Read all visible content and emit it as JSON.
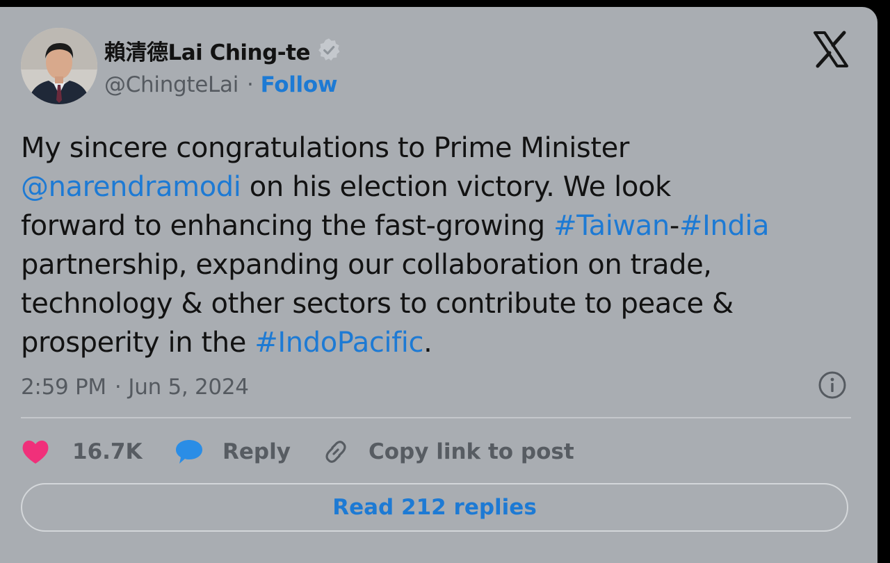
{
  "author": {
    "display_name": "賴清德Lai Ching-te",
    "handle": "@ChingteLai",
    "separator": "·",
    "follow_label": "Follow"
  },
  "tweet": {
    "line1": "My sincere congratulations to Prime Minister",
    "mention": "@narendramodi",
    "line2_rest": " on his election victory. We look",
    "line3_start": "forward to enhancing the fast-growing ",
    "hashtag_taiwan": "#Taiwan",
    "dash": "-",
    "hashtag_india": "#India",
    "line4": "partnership, expanding our collaboration on trade,",
    "line5": "technology & other sectors to contribute to peace &",
    "line6_start": "prosperity in the ",
    "hashtag_indopacific": "#IndoPacific",
    "line6_end": "."
  },
  "meta": {
    "time": "2:59 PM",
    "separator": "·",
    "date": "Jun 5, 2024"
  },
  "actions": {
    "like_count": "16.7K",
    "reply_label": "Reply",
    "copy_label": "Copy link to post"
  },
  "read_replies_label": "Read 212 replies",
  "colors": {
    "card_bg": "#a9adb2",
    "link_blue": "#1d7ad4",
    "heart_pink": "#f0307a",
    "reply_blue": "#2a8de6",
    "muted_text": "#555a60"
  },
  "icons": [
    "verified-badge-icon",
    "x-logo-icon",
    "info-icon",
    "heart-icon",
    "reply-bubble-icon",
    "link-icon"
  ]
}
